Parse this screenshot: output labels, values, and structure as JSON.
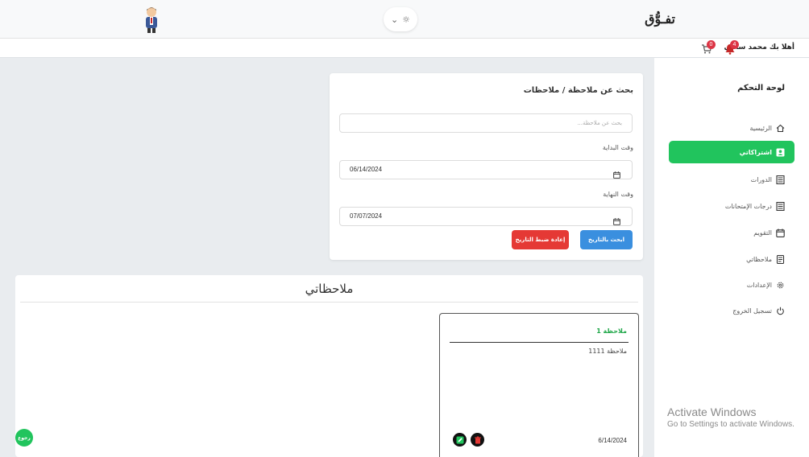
{
  "header": {
    "brand": "تفـوُّق"
  },
  "subheader": {
    "welcome": "أهلا بك محمد سامي",
    "notification_count": "4",
    "cart_count": "0"
  },
  "sidebar": {
    "title": "لوحة التحكم",
    "items": [
      {
        "label": "الرئيسية",
        "icon": "home-icon"
      },
      {
        "label": "اشتراكاتي",
        "icon": "user-square-icon",
        "active": true
      },
      {
        "label": "الدورات",
        "icon": "list-icon"
      },
      {
        "label": "درجات الإمتحانات",
        "icon": "list-icon"
      },
      {
        "label": "التقويم",
        "icon": "calendar-icon"
      },
      {
        "label": "ملاحظاتي",
        "icon": "note-icon"
      },
      {
        "label": "الإعدادات",
        "icon": "gear-icon"
      },
      {
        "label": "تسجيل الخروج",
        "icon": "power-icon"
      }
    ]
  },
  "search": {
    "title": "بحث عن ملاحظة / ملاحظات",
    "placeholder": "بحث عن ملاحظة...",
    "start_label": "وقت البداية",
    "start_value": "06/14/2024",
    "end_label": "وقت النهاية",
    "end_value": "07/07/2024",
    "search_button": "ابحث بالتاريخ",
    "reset_button": "إعادة ضبط التاريخ"
  },
  "notes": {
    "title": "ملاحظاتي",
    "items": [
      {
        "title": "ملاحظة 1",
        "body": "ملاحظة 1111",
        "date": "6/14/2024"
      }
    ]
  },
  "back_button": "رجوع",
  "windows_watermark": {
    "line1": "Activate Windows",
    "line2": "Go to Settings to activate Windows."
  },
  "colors": {
    "accent_green": "#21c45d",
    "primary_blue": "#3a8fdf",
    "danger_red": "#e53935"
  }
}
